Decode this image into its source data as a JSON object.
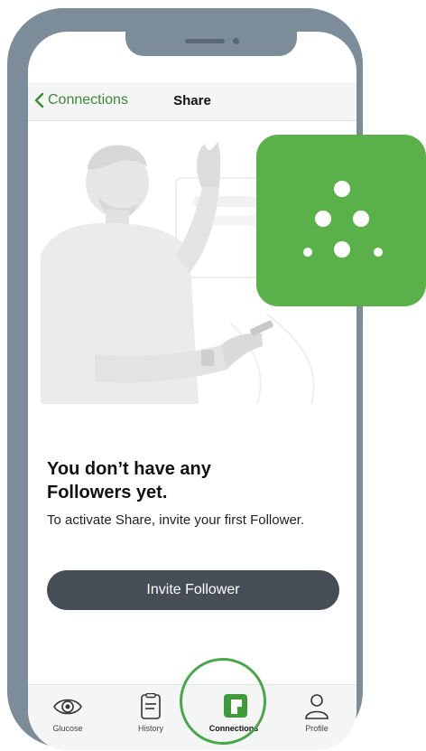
{
  "nav": {
    "back_label": "Connections",
    "title": "Share"
  },
  "empty_state": {
    "title_line1": "You don’t have any",
    "title_line2": "Followers yet.",
    "subtitle": "To activate Share, invite your first Follower."
  },
  "invite_button": {
    "label": "Invite Follower"
  },
  "tabs": [
    {
      "label": "Glucose",
      "icon": "glucose-eye-icon",
      "active": false
    },
    {
      "label": "History",
      "icon": "history-clipboard-icon",
      "active": false
    },
    {
      "label": "Connections",
      "icon": "connections-icon",
      "active": true
    },
    {
      "label": "Profile",
      "icon": "profile-person-icon",
      "active": false
    }
  ],
  "colors": {
    "accent_green": "#3b8a34",
    "logo_green": "#5ab14a",
    "button_dark": "#454d56",
    "frame_gray": "#7d8c99"
  }
}
